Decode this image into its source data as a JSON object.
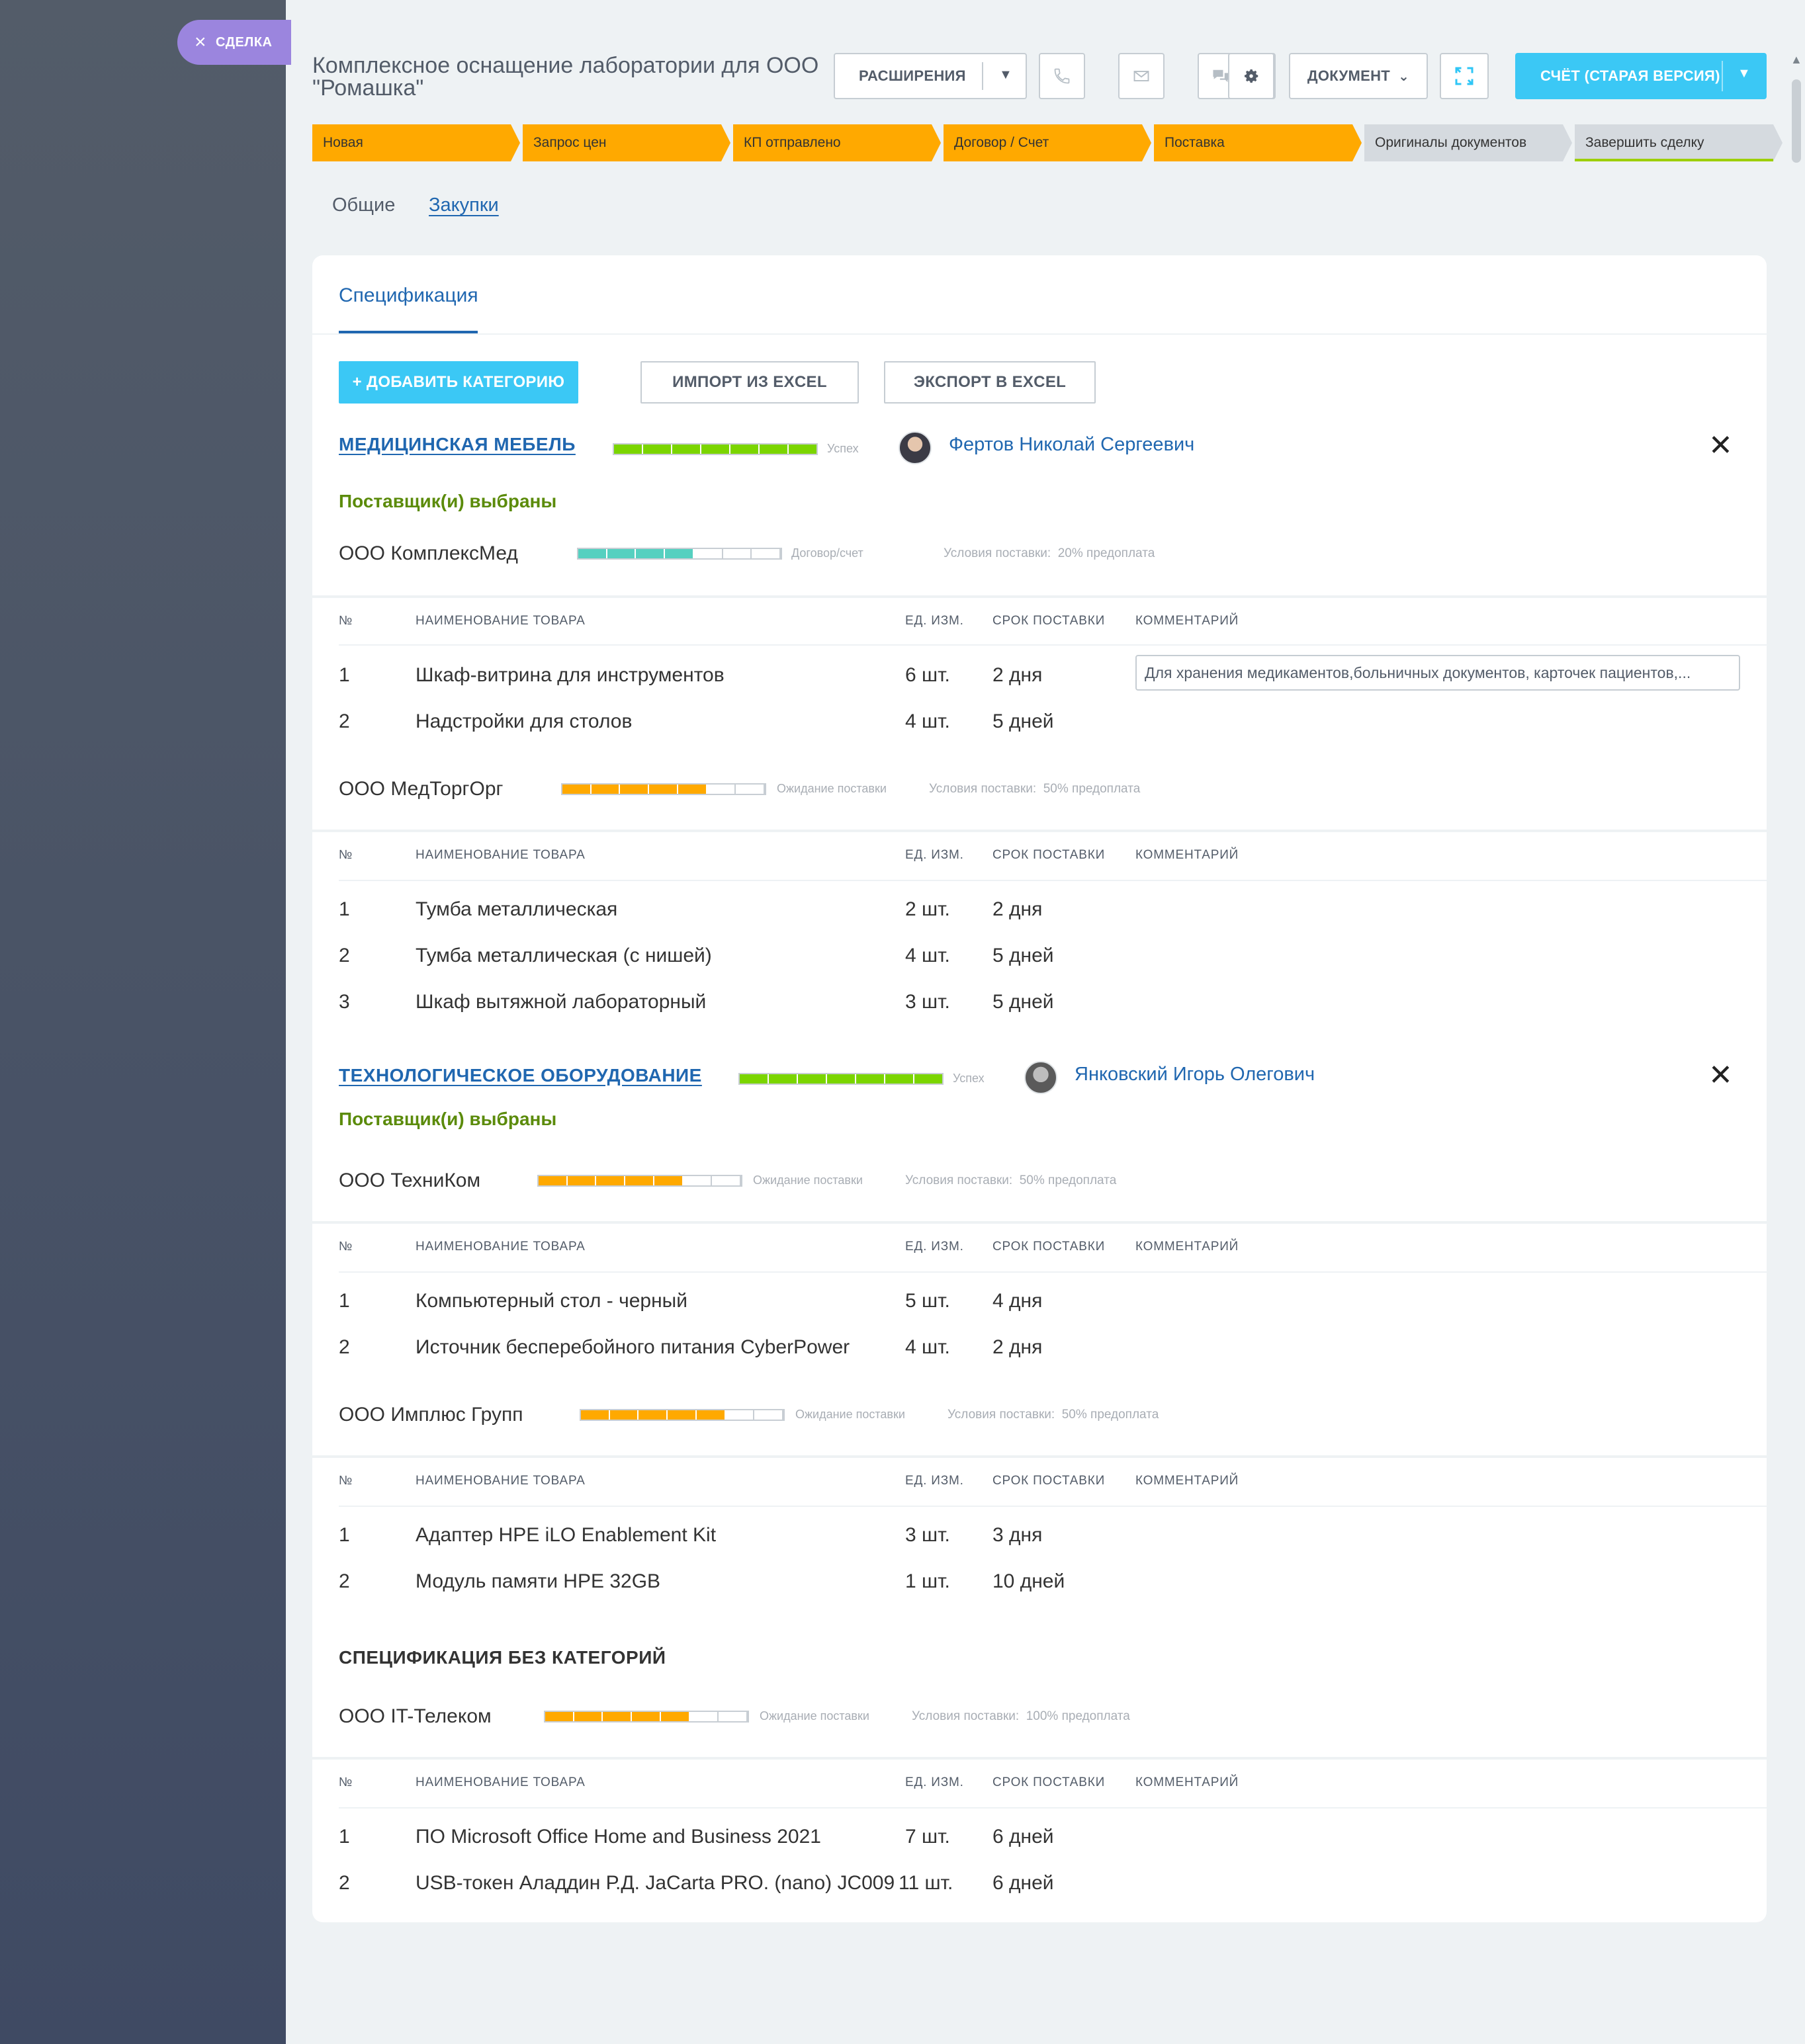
{
  "deal_tab": {
    "label": "СДЕЛКА"
  },
  "header": {
    "title_line1": "Комплексное оснащение лаборатории для ООО",
    "title_line2": "\"Ромашка\"",
    "extensions_label": "РАСШИРЕНИЯ",
    "document_label": "ДОКУМЕНТ",
    "invoice_label": "СЧЁТ (СТАРАЯ ВЕРСИЯ)"
  },
  "stages": [
    {
      "label": "Новая",
      "color": "#ffa900"
    },
    {
      "label": "Запрос цен",
      "color": "#ffa900"
    },
    {
      "label": "КП отправлено",
      "color": "#ffa900"
    },
    {
      "label": "Договор / Счет",
      "color": "#ffa900"
    },
    {
      "label": "Поставка",
      "color": "#ffa900"
    },
    {
      "label": "Оригиналы документов",
      "color": "#d5dadf"
    },
    {
      "label": "Завершить сделку",
      "color": "#d5dadf"
    }
  ],
  "page_tabs": [
    {
      "label": "Общие",
      "active": false
    },
    {
      "label": "Закупки",
      "active": true
    }
  ],
  "spec": {
    "tab_label": "Спецификация",
    "add_category": "+ ДОБАВИТЬ КАТЕГОРИЮ",
    "import_excel": "ИМПОРТ ИЗ EXCEL",
    "export_excel": "ЭКСПОРТ В EXCEL"
  },
  "table_headers": {
    "num": "№",
    "name": "НАИМЕНОВАНИЕ ТОВАРА",
    "unit": "ЕД. ИЗМ.",
    "term": "СРОК ПОСТАВКИ",
    "comment": "КОММЕНТАРИЙ"
  },
  "colors": {
    "success": "#7bd500",
    "contract": "#55d0c0",
    "waiting": "#ffa900",
    "accent": "#3bc8f5",
    "link": "#2067b0"
  },
  "categories": [
    {
      "title": "МЕДИЦИНСКАЯ МЕБЕЛЬ",
      "status": "Успех",
      "progress": 1.0,
      "responsible": "Фертов Николай Сергеевич",
      "selected_label": "Поставщик(и) выбраны",
      "suppliers": [
        {
          "name": "ООО КомплексМед",
          "status": "Договор/счет",
          "progress": 0.57,
          "terms_label": "Условия поставки:",
          "terms_value": "20% предоплата",
          "items": [
            {
              "num": "1",
              "name": "Шкаф-витрина для инструментов",
              "unit": "6 шт.",
              "term": "2 дня",
              "comment": "Для хранения медикаментов,больничных документов, карточек пациентов,..."
            },
            {
              "num": "2",
              "name": "Надстройки для столов",
              "unit": "4 шт.",
              "term": "5 дней",
              "comment": ""
            }
          ]
        },
        {
          "name": "ООО МедТоргОрг",
          "status": "Ожидание поставки",
          "progress": 0.71,
          "terms_label": "Условия поставки:",
          "terms_value": "50% предоплата",
          "items": [
            {
              "num": "1",
              "name": "Тумба металлическая",
              "unit": "2 шт.",
              "term": "2 дня"
            },
            {
              "num": "2",
              "name": "Тумба металлическая (с нишей)",
              "unit": "4 шт.",
              "term": "5 дней"
            },
            {
              "num": "3",
              "name": "Шкаф вытяжной лабораторный",
              "unit": "3 шт.",
              "term": "5 дней"
            }
          ]
        }
      ]
    },
    {
      "title": "ТЕХНОЛОГИЧЕСКОЕ ОБОРУДОВАНИЕ",
      "status": "Успех",
      "progress": 1.0,
      "responsible": "Янковский Игорь Олегович",
      "selected_label": "Поставщик(и) выбраны",
      "suppliers": [
        {
          "name": "ООО ТехниКом",
          "status": "Ожидание поставки",
          "progress": 0.71,
          "terms_label": "Условия поставки:",
          "terms_value": "50% предоплата",
          "items": [
            {
              "num": "1",
              "name": "Компьютерный стол - черный",
              "unit": "5 шт.",
              "term": "4 дня"
            },
            {
              "num": "2",
              "name": "Источник бесперебойного питания CyberPower",
              "unit": "4 шт.",
              "term": "2 дня"
            }
          ]
        },
        {
          "name": "ООО Имплюс Групп",
          "status": "Ожидание поставки",
          "progress": 0.71,
          "terms_label": "Условия поставки:",
          "terms_value": "50% предоплата",
          "items": [
            {
              "num": "1",
              "name": "Адаптер HPE iLO Enablement Kit",
              "unit": "3 шт.",
              "term": "3 дня"
            },
            {
              "num": "2",
              "name": "Модуль памяти HPE 32GB",
              "unit": "1 шт.",
              "term": "10 дней"
            }
          ]
        }
      ]
    }
  ],
  "uncategorized": {
    "title": "СПЕЦИФИКАЦИЯ БЕЗ КАТЕГОРИЙ",
    "supplier": {
      "name": "ООО IT-Телеком",
      "status": "Ожидание поставки",
      "progress": 0.71,
      "terms_label": "Условия поставки:",
      "terms_value": "100% предоплата",
      "items": [
        {
          "num": "1",
          "name": "ПО Microsoft Office Home and Business 2021",
          "unit": "7 шт.",
          "term": "6 дней"
        },
        {
          "num": "2",
          "name": "USB-токен Аладдин Р.Д. JaCarta PRO. (nano) JC009",
          "unit": "11 шт.",
          "term": "6 дней"
        }
      ]
    }
  }
}
